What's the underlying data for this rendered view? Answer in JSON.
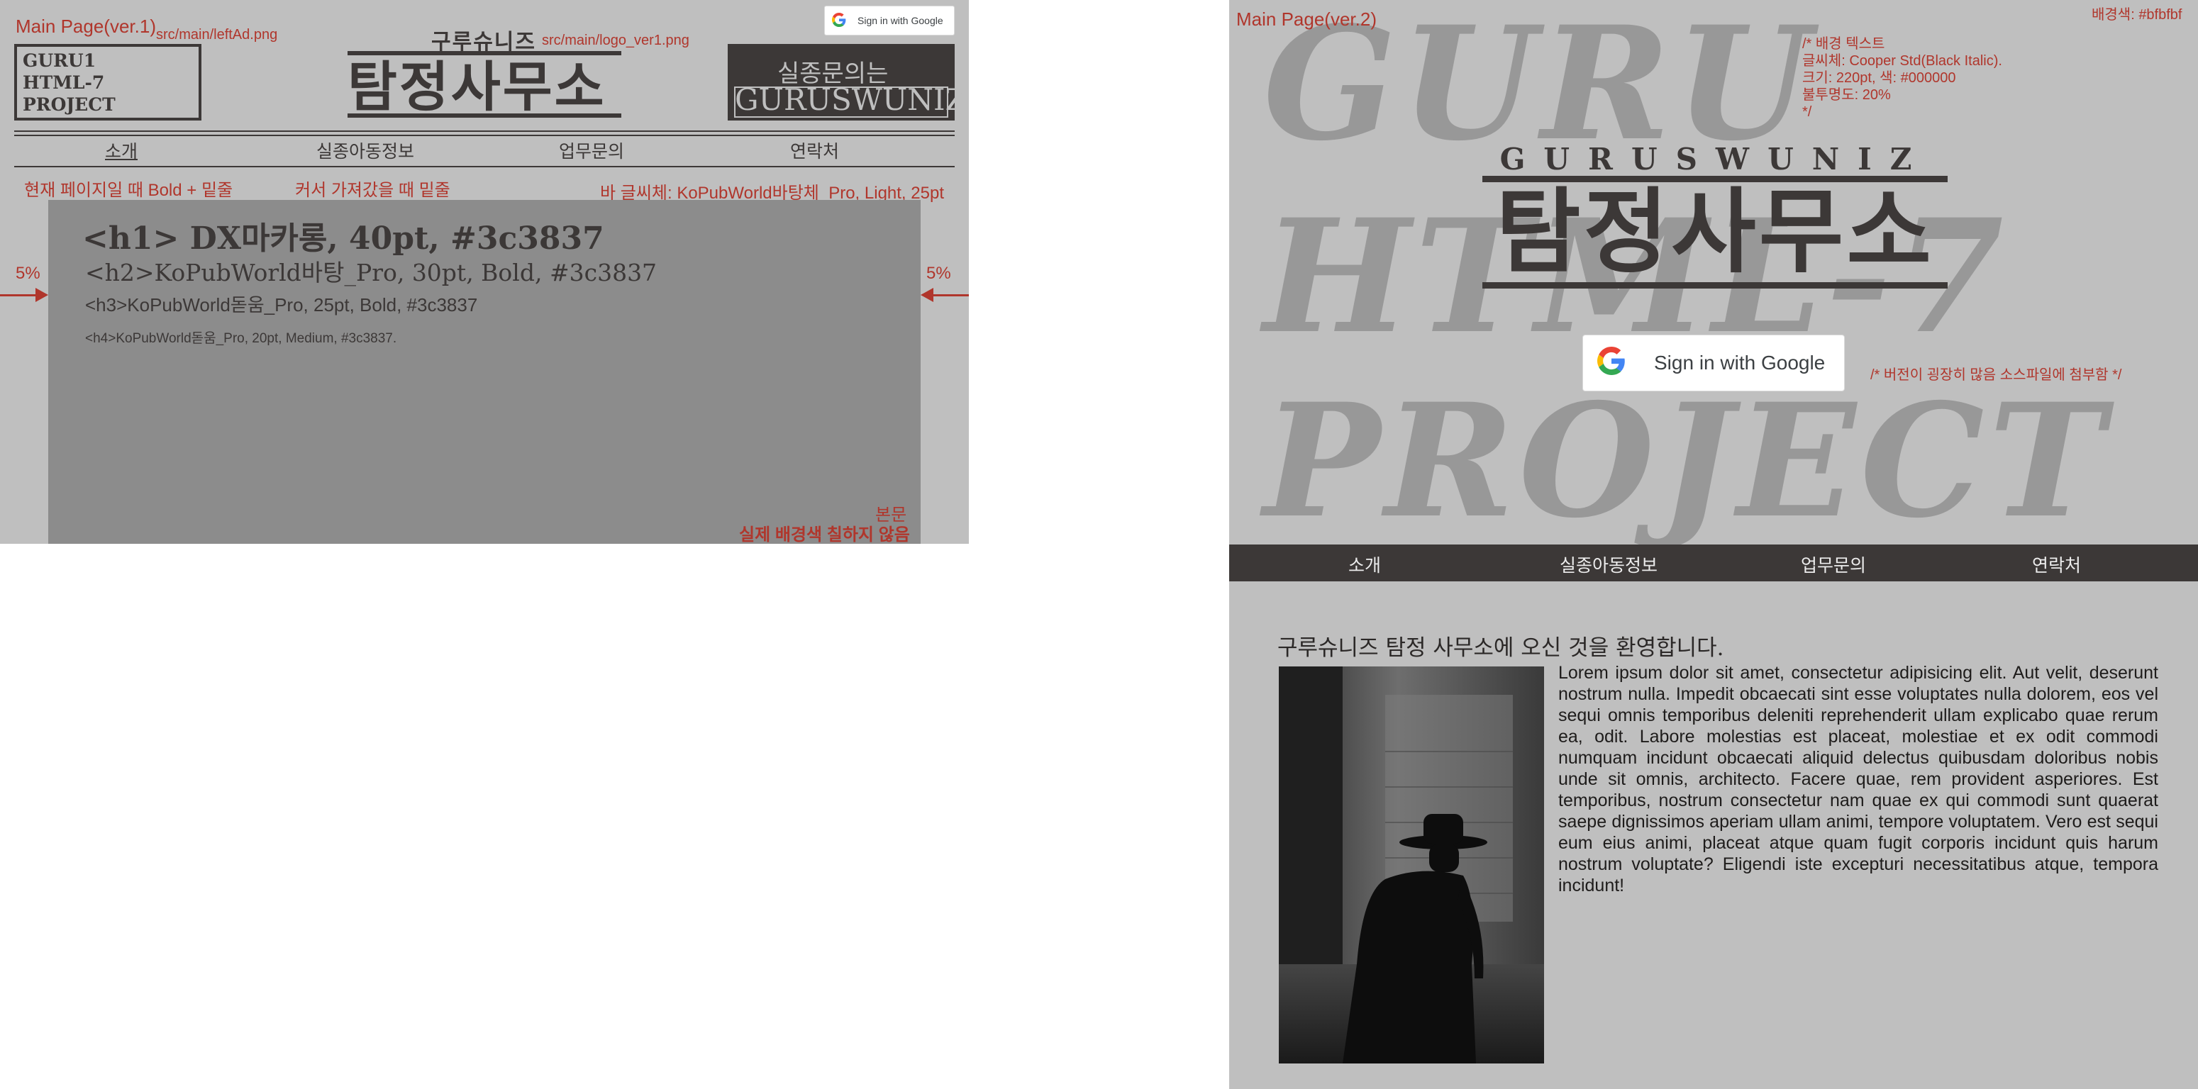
{
  "panel1": {
    "title": "Main Page(ver.1)",
    "left_ad_path": "src/main/leftAd.png",
    "logo_path": "src/main/logo_ver1.png",
    "google_button": "Sign in with Google",
    "left_box": [
      "GURU1",
      "HTML-7",
      "PROJECT"
    ],
    "logo_sub": "구루슈니즈",
    "logo_main": "탐정사무소",
    "right_box": {
      "line1": "실종문의는",
      "line2": "GURUSWUNIZ"
    },
    "nav": [
      "소개",
      "실종아동정보",
      "업무문의",
      "연락처"
    ],
    "notes": {
      "current_page": "현재 페이지일 때 Bold + 밑줄",
      "hover": "커서 가져갔을 때 밑줄",
      "bar_font": "바 글씨체: KoPubWorld바탕체_Pro, Light, 25pt"
    },
    "margin_left": "5%",
    "margin_right": "5%",
    "headings": {
      "h1": "<h1> DX마카롱, 40pt, #3c3837",
      "h2": "<h2>KoPubWorld바탕_Pro, 30pt, Bold, #3c3837",
      "h3": "<h3>KoPubWorld돋움_Pro, 25pt, Bold, #3c3837",
      "h4": "<h4>KoPubWorld돋움_Pro, 20pt, Medium, #3c3837."
    },
    "body_note": {
      "line1": "본문",
      "line2": "실제 배경색 칠하지 않음"
    }
  },
  "panel2": {
    "title": "Main Page(ver.2)",
    "bg_color_note": "배경색: #bfbfbf",
    "bg_note": [
      "/* 배경 텍스트",
      "글씨체: Cooper Std(Black Italic).",
      "크기: 220pt, 색: #000000",
      "불투명도: 20%",
      "*/"
    ],
    "bg_words": [
      "GURU",
      "HTML-7",
      "PROJECT"
    ],
    "logo_sub": "GURUSWUNIZ",
    "logo_main": "탐정사무소",
    "google_button": "Sign in with Google",
    "font_note": "/* 버전이 굉장히 많음 소스파일에 첨부함 */",
    "nav": [
      "소개",
      "실종아동정보",
      "업무문의",
      "연락처"
    ],
    "welcome": "구루슈니즈 탐정 사무소에 오신 것을 환영합니다.",
    "lorem": "Lorem ipsum dolor sit amet, consectetur adipisicing elit. Aut velit, deserunt nostrum nulla. Impedit obcaecati sint esse voluptates nulla dolorem, eos vel sequi omnis temporibus deleniti reprehenderit ullam explicabo quae rerum ea, odit. Labore molestias est placeat, molestiae et ex odit commodi numquam incidunt obcaecati aliquid delectus quibusdam doloribus nobis unde sit omnis, architecto. Facere quae, rem provident asperiores. Est temporibus, nostrum consectetur nam quae ex qui commodi sunt quaerat saepe dignissimos aperiam ullam animi, tempore voluptatem. Vero est sequi eum eius animi, placeat atque quam fugit corporis incidunt quis harum nostrum voluptate? Eligendi iste excepturi necessitatibus atque, tempora incidunt!"
  },
  "colors": {
    "background": "#bfbfbf",
    "text": "#3c3837",
    "annotation": "#b0362c",
    "content_box": "#8c8c8c"
  }
}
